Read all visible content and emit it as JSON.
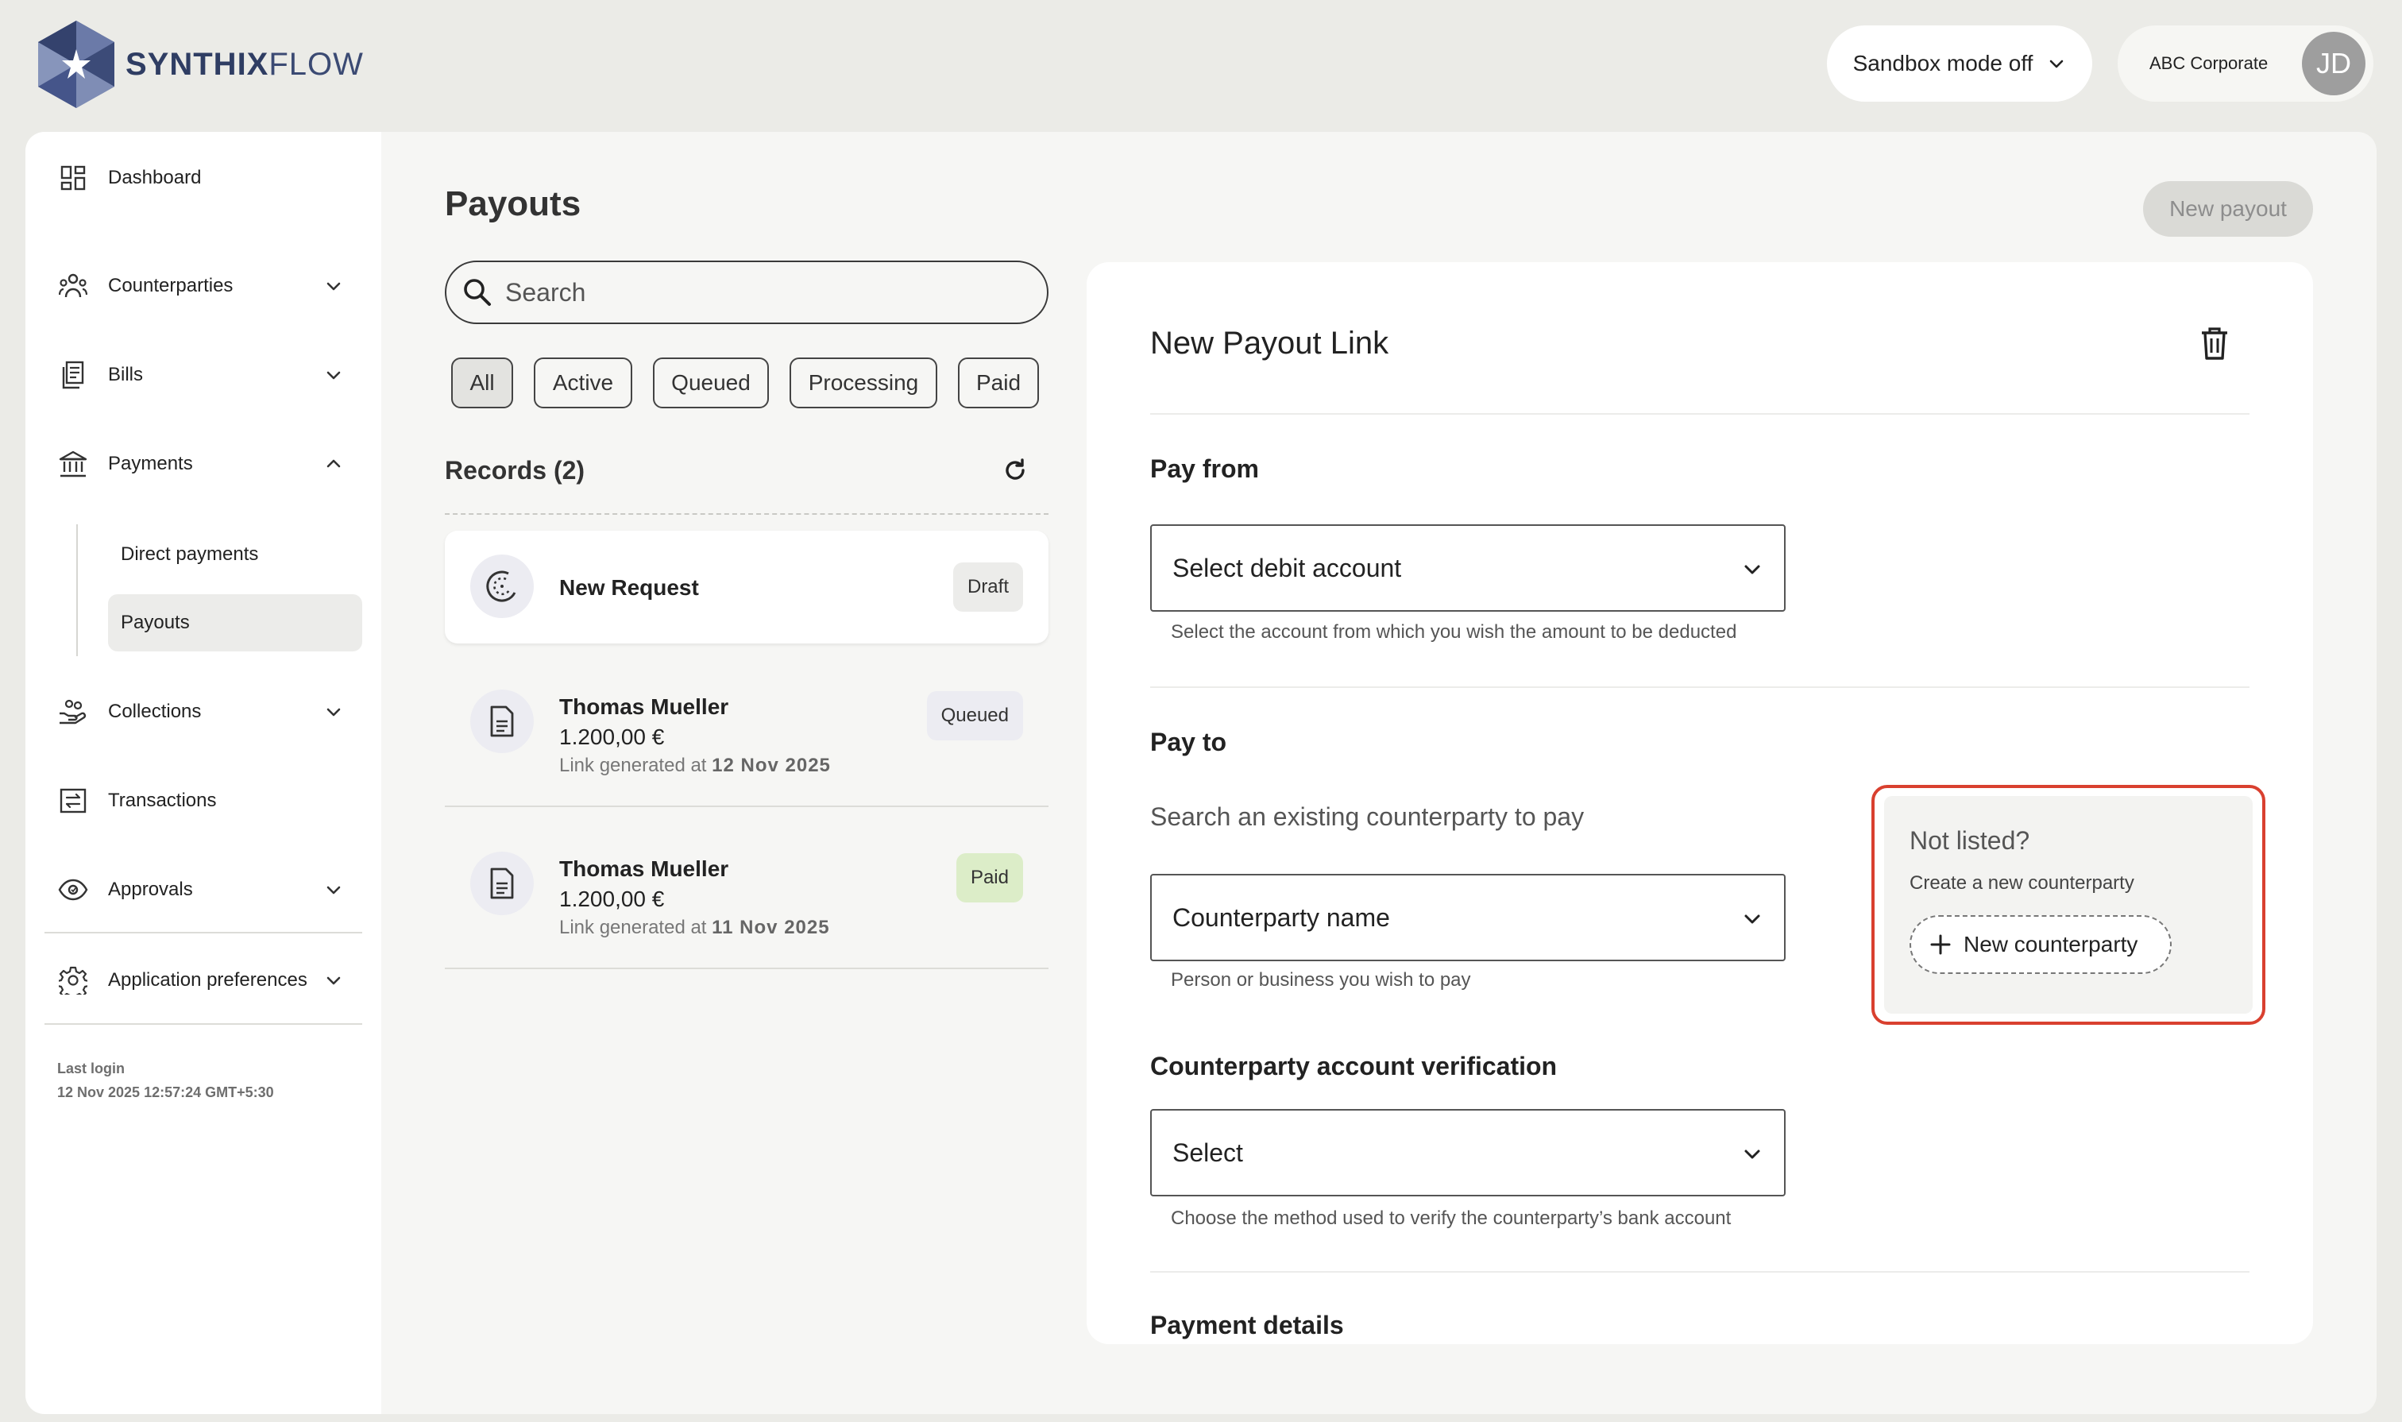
{
  "header": {
    "logo_bold": "SYNTHIX",
    "logo_light": "FLOW",
    "sandbox_label": "Sandbox mode off",
    "org_name": "ABC Corporate",
    "avatar_initials": "JD"
  },
  "sidebar": {
    "items": [
      {
        "label": "Dashboard",
        "icon": "dashboard-icon"
      },
      {
        "label": "Counterparties",
        "icon": "people-icon"
      },
      {
        "label": "Bills",
        "icon": "bills-icon"
      },
      {
        "label": "Payments",
        "icon": "bank-icon"
      },
      {
        "label": "Collections",
        "icon": "hand-coins-icon"
      },
      {
        "label": "Transactions",
        "icon": "transfer-icon"
      },
      {
        "label": "Approvals",
        "icon": "eye-icon"
      },
      {
        "label": "Application preferences",
        "icon": "gear-icon"
      }
    ],
    "payments_sub": [
      "Direct payments",
      "Payouts"
    ],
    "last_login_label": "Last login",
    "last_login_value": "12 Nov 2025 12:57:24 GMT+5:30"
  },
  "list": {
    "title": "Payouts",
    "new_payout_label": "New payout",
    "search_placeholder": "Search",
    "filters": [
      "All",
      "Active",
      "Queued",
      "Processing",
      "Paid"
    ],
    "records_title": "Records (2)",
    "records": [
      {
        "name": "New Request",
        "status": "Draft"
      },
      {
        "name": "Thomas Mueller",
        "amount": "1.200,00 €",
        "meta_prefix": "Link generated at ",
        "date": "12 Nov 2025",
        "status": "Queued"
      },
      {
        "name": "Thomas Mueller",
        "amount": "1.200,00 €",
        "meta_prefix": "Link generated at ",
        "date": "11 Nov 2025",
        "status": "Paid"
      }
    ]
  },
  "panel": {
    "title": "New Payout Link",
    "pay_from": {
      "heading": "Pay from",
      "select_value": "Select debit account",
      "help": "Select the account from which you wish the amount to be deducted"
    },
    "pay_to": {
      "heading": "Pay to",
      "subtitle": "Search an existing counterparty to pay",
      "select_value": "Counterparty name",
      "help": "Person or business you wish to pay"
    },
    "not_listed": {
      "title": "Not listed?",
      "subtitle": "Create a new counterparty",
      "button": "New counterparty"
    },
    "verification": {
      "heading": "Counterparty account verification",
      "select_value": "Select",
      "help": "Choose the method used to verify the counterparty’s bank account"
    },
    "payment_details_heading": "Payment details"
  },
  "colors": {
    "page_bg": "#ebebe7",
    "brand": "#2f3d63",
    "highlight_outline": "#d9402f",
    "badge_draft": "#ececea",
    "badge_queued": "#ececf2",
    "badge_paid": "#dcedc8"
  }
}
